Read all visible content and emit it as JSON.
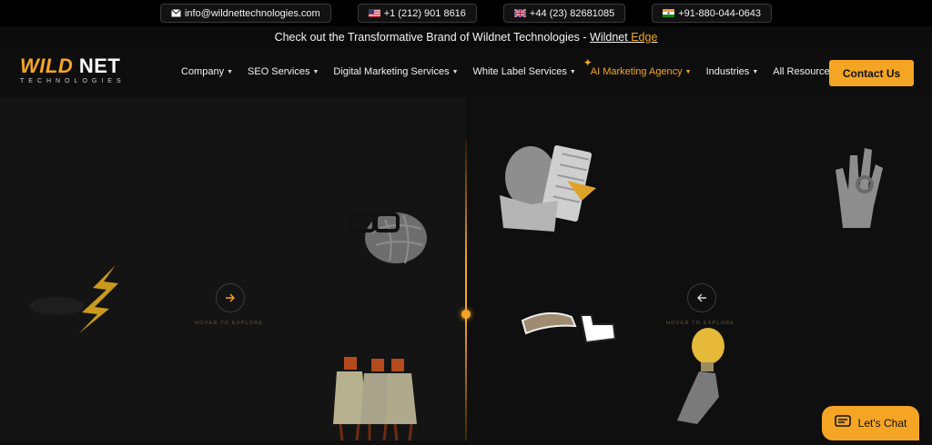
{
  "topbar": {
    "email": "info@wildnettechnologies.com",
    "phone_us": "+1 (212) 901 8616",
    "phone_uk": "+44 (23) 82681085",
    "phone_in": "+91-880-044-0643"
  },
  "announcement": {
    "text": "Check out the Transformative Brand of Wildnet Technologies - ",
    "link_word_1": "Wildnet",
    "link_word_2": "Edge"
  },
  "logo": {
    "wild": "WILD",
    "net": "NET",
    "tagline": "TECHNOLOGIES"
  },
  "nav": {
    "items": [
      {
        "label": "Company"
      },
      {
        "label": "SEO Services"
      },
      {
        "label": "Digital Marketing Services"
      },
      {
        "label": "White Label Services"
      },
      {
        "label": "AI Marketing Agency"
      },
      {
        "label": "Industries"
      },
      {
        "label": "All Resources"
      }
    ],
    "contact": "Contact Us"
  },
  "hero": {
    "left_hover": "HOVER TO EXPLORE",
    "right_hover": "HOVER TO EXPLORE"
  },
  "chat": {
    "label": "Let's Chat"
  },
  "colors": {
    "accent": "#f5a524",
    "background": "#0e0e0e"
  }
}
